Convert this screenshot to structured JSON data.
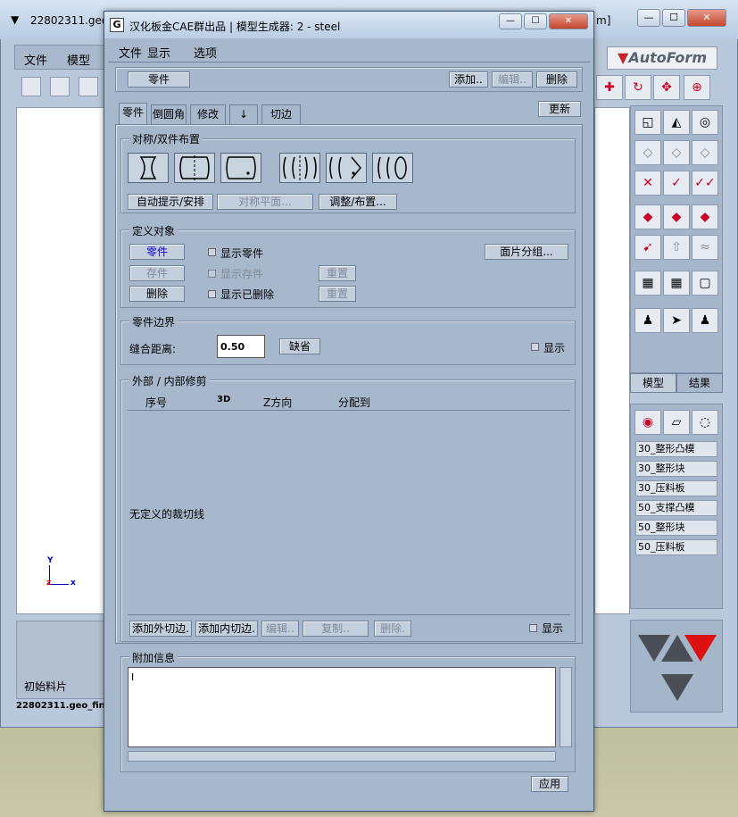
{
  "background_window": {
    "title": "22802311.geo",
    "title_right": "m]",
    "menu": [
      "文件",
      "模型"
    ],
    "brand": "AutoForm",
    "status_label": "初始料片",
    "file_label": "22802311.geo_fin0",
    "right_tabs": [
      "模型",
      "结果"
    ],
    "tool_list": [
      "30_整形凸模",
      "30_整形块",
      "30_压料板",
      "50_支撑凸模",
      "50_整形块",
      "50_压料板"
    ]
  },
  "dialog": {
    "title": "汉化板金CAE群出品 | 模型生成器: 2  -  steel",
    "icon_letter": "G",
    "menu": {
      "file": "文件",
      "view": "显示",
      "options": "选项"
    },
    "top": {
      "field": "零件",
      "add": "添加..",
      "edit": "编辑..",
      "delete": "删除"
    },
    "tabs": [
      "零件",
      "倒圆角",
      "修改",
      "↓",
      "切边"
    ],
    "update": "更新",
    "sym": {
      "title": "对称/双件布置",
      "auto": "自动提示/安排",
      "plane": "对称平面...",
      "adjust": "调整/布置..."
    },
    "define": {
      "title": "定义对象",
      "part": "零件",
      "show_part": "显示零件",
      "face_group": "面片分组...",
      "remain": "存件",
      "show_remain": "显示存件",
      "reset1": "重置",
      "delete": "删除",
      "show_deleted": "显示已删除",
      "reset2": "重置"
    },
    "boundary": {
      "title": "零件边界",
      "sew_label": "缝合距离:",
      "sew_value": "0.50",
      "default": "缺省",
      "show": "显示"
    },
    "trim": {
      "title": "外部 / 内部修剪",
      "cols": [
        "序号",
        "3D",
        "Z方向",
        "分配到"
      ],
      "empty": "无定义的裁切线",
      "add_outer": "添加外切边.",
      "add_inner": "添加内切边.",
      "edit": "编辑..",
      "copy": "复制..",
      "delete": "删除.",
      "show": "显示"
    },
    "extra": {
      "title": "附加信息",
      "text": ""
    },
    "apply": "应用"
  }
}
